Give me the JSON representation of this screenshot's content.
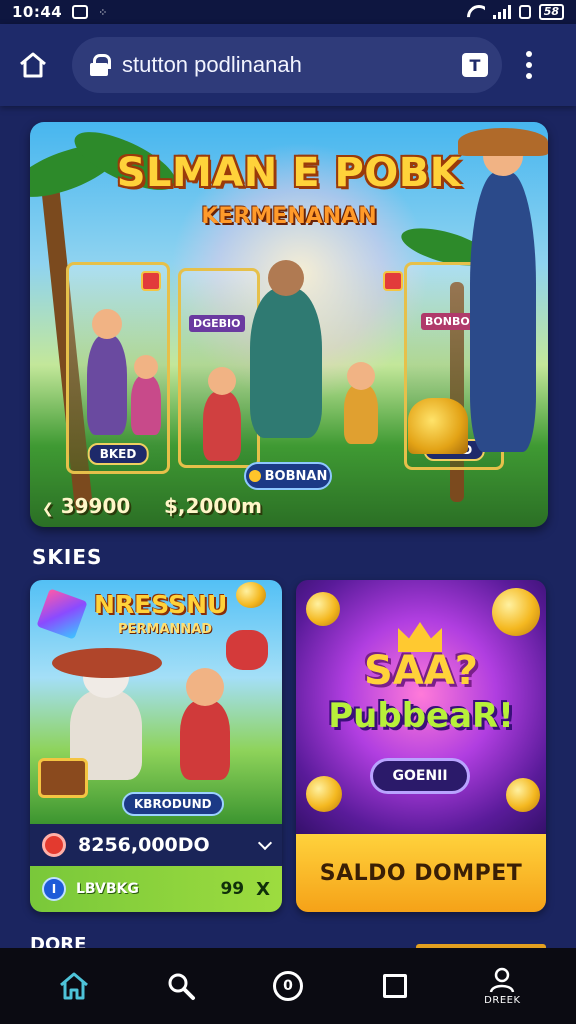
{
  "status_bar": {
    "time": "10:44",
    "battery": "58"
  },
  "browser": {
    "url": "stutton podlinanah",
    "tab_icon_label": "T"
  },
  "hero": {
    "title": "SLMAN E POBK",
    "subtitle": "KERMENANAN",
    "panel_left_tag": "BKED",
    "panel_right_tag": "BRED",
    "panel_left_sign": "DGEBIO",
    "panel_right_sign": "BONBOC",
    "bonus_label": "BOBNAN",
    "amount_left": "39900",
    "amount_right": "$,2000m"
  },
  "section": {
    "title": "SKIES"
  },
  "promo_left": {
    "title": "NRESSNU",
    "subtitle": "PERMANNAD",
    "tag": "KBRODUND",
    "value": "8256,000DO",
    "green_label": "LBVBKG",
    "green_count": "99",
    "green_close": "X",
    "blue_badge": "I"
  },
  "promo_right": {
    "title_line1": "SAA?",
    "title_line2": "PubbeaR!",
    "button_label": "GOENII",
    "cta_label": "SALDO DOMPET"
  },
  "next_section": {
    "title": "DORE"
  },
  "bottom_nav": {
    "profile_caption": "DREEK"
  },
  "colors": {
    "background": "#1b2560",
    "accent_gold": "#ffd23a",
    "cta_orange": "#f5a218",
    "green_row": "#79c83a"
  }
}
